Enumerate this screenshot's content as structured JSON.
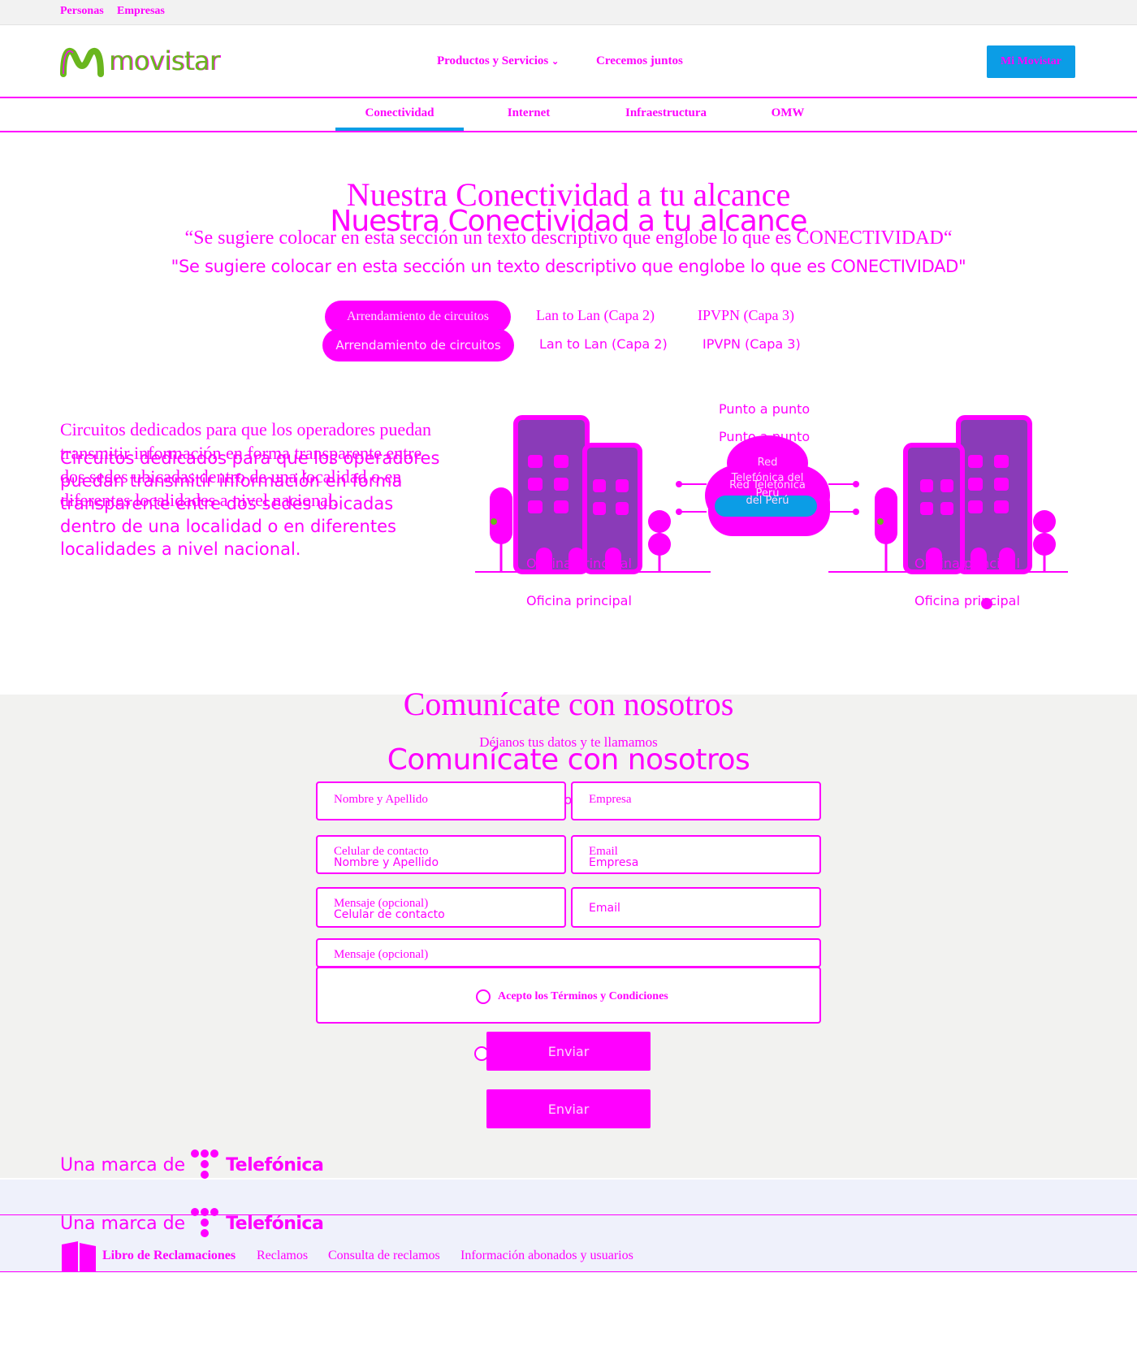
{
  "topbar": {
    "personas": "Personas",
    "empresas": "Empresas"
  },
  "header": {
    "logo_text": "movistar",
    "nav": {
      "products": "Productos y Servicios",
      "together": "Crecemos juntos"
    },
    "mi_movistar": "Mi Movistar"
  },
  "subtabs": [
    "Conectividad",
    "Internet",
    "Infraestructura",
    "OMW"
  ],
  "hero": {
    "title": "Nuestra Conectividad a tu alcance",
    "subtitle": "“Se sugiere colocar en esta sección un texto descriptivo que englobe lo que es CONECTIVIDAD“",
    "subtitle_alt": "\"Se sugiere colocar en esta sección un texto descriptivo que englobe lo que es CONECTIVIDAD\"",
    "options": [
      "Arrendamiento de circuitos",
      "Lan to Lan (Capa 2)",
      "IPVPN (Capa 3)"
    ]
  },
  "description": "Circuitos dedicados para que los operadores puedan transmitir información en forma transparente entre dos sedes ubicadas dentro de una localidad o en diferentes localidades a nivel nacional.",
  "illustration": {
    "connection_label": "Punto a punto",
    "network_label": "Red Telefónica del Perú",
    "office_label": "Oficina principal"
  },
  "contact": {
    "title": "Comunícate con nosotros",
    "subtitle": "Déjanos tus datos y te llamamos",
    "fields": {
      "name": "Nombre y Apellido",
      "company": "Empresa",
      "phone": "Celular de contacto",
      "email": "Email",
      "message": "Mensaje (opcional)"
    },
    "terms": "Acepto los Términos y Condiciones",
    "send": "Enviar"
  },
  "brand": {
    "prefix": "Una marca de",
    "name": "Telefónica"
  },
  "footer": {
    "links": [
      "Libro de Reclamaciones",
      "Reclamos",
      "Consulta de reclamos",
      "Información abonados y usuarios"
    ]
  },
  "colors": {
    "accent": "#ff00ff",
    "blue": "#0b9de6",
    "green": "#6ab61e",
    "building": "#8a3bb8"
  }
}
